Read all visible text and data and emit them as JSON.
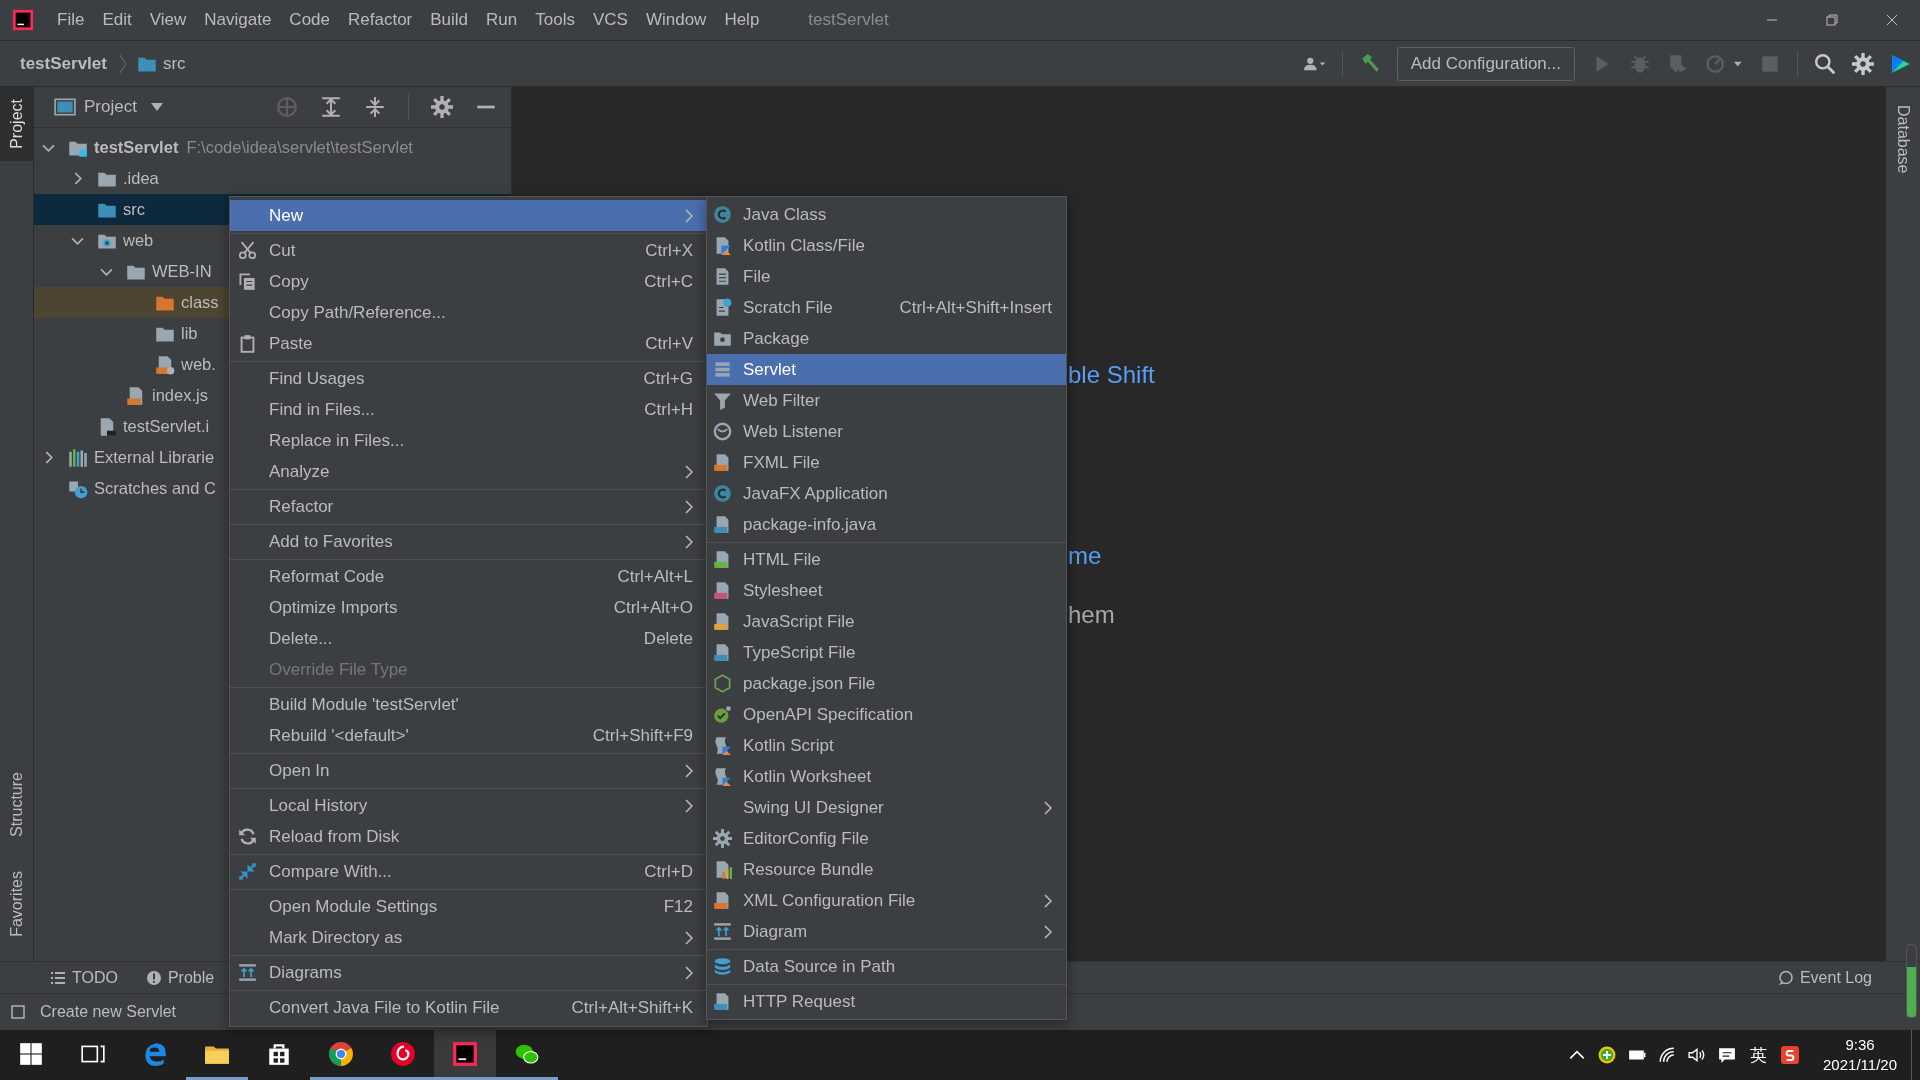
{
  "window": {
    "title": "testServlet"
  },
  "menu_bar": [
    "File",
    "Edit",
    "View",
    "Navigate",
    "Code",
    "Refactor",
    "Build",
    "Run",
    "Tools",
    "VCS",
    "Window",
    "Help"
  ],
  "nav_bar": {
    "breadcrumbs": [
      "testServlet",
      "src"
    ],
    "run_config": "Add Configuration..."
  },
  "left_stripe": [
    {
      "label": "Project",
      "selected": true
    },
    {
      "label": "Structure",
      "selected": false
    },
    {
      "label": "Favorites",
      "selected": false
    }
  ],
  "right_stripe": [
    {
      "label": "Database",
      "selected": false
    }
  ],
  "project_panel": {
    "title": "Project",
    "tree": [
      {
        "label": "testServlet",
        "kind": "module",
        "path": "F:\\code\\idea\\servlet\\testServlet",
        "expanded": true,
        "selected": false,
        "children": [
          {
            "label": ".idea",
            "kind": "folder",
            "expanded": false,
            "selected": false
          },
          {
            "label": "src",
            "kind": "source",
            "selected": true
          },
          {
            "label": "web",
            "kind": "web",
            "expanded": true,
            "selected": false,
            "children": [
              {
                "label": "WEB-IN",
                "kind": "folder",
                "expanded": true,
                "selected": false,
                "children": [
                  {
                    "label": "class",
                    "kind": "output",
                    "selected": false
                  },
                  {
                    "label": "lib",
                    "kind": "folder",
                    "selected": false
                  },
                  {
                    "label": "web.",
                    "kind": "xml",
                    "selected": false
                  }
                ]
              },
              {
                "label": "index.js",
                "kind": "jsp",
                "selected": false
              }
            ]
          },
          {
            "label": "testServlet.i",
            "kind": "iml",
            "selected": false
          }
        ]
      },
      {
        "label": "External Librarie",
        "kind": "libraries",
        "expanded": false,
        "selected": false
      },
      {
        "label": "Scratches and C",
        "kind": "scratches",
        "selected": false
      }
    ]
  },
  "editor_hints": [
    {
      "text": "ble Shift",
      "kind": "link"
    },
    {
      "text": "me",
      "kind": "link"
    },
    {
      "text": "hem",
      "kind": "plain"
    }
  ],
  "context_menu": {
    "groups": [
      [
        {
          "label": "New",
          "has_submenu": true,
          "selected": true,
          "disabled": false
        }
      ],
      [
        {
          "label": "Cut",
          "shortcut": "Ctrl+X",
          "has_submenu": false,
          "selected": false,
          "disabled": false
        },
        {
          "label": "Copy",
          "shortcut": "Ctrl+C",
          "has_submenu": false,
          "selected": false,
          "disabled": false
        },
        {
          "label": "Copy Path/Reference...",
          "has_submenu": false,
          "selected": false,
          "disabled": false
        },
        {
          "label": "Paste",
          "shortcut": "Ctrl+V",
          "has_submenu": false,
          "selected": false,
          "disabled": false
        }
      ],
      [
        {
          "label": "Find Usages",
          "shortcut": "Ctrl+G",
          "has_submenu": false,
          "selected": false,
          "disabled": false
        },
        {
          "label": "Find in Files...",
          "shortcut": "Ctrl+H",
          "has_submenu": false,
          "selected": false,
          "disabled": false
        },
        {
          "label": "Replace in Files...",
          "has_submenu": false,
          "selected": false,
          "disabled": false
        },
        {
          "label": "Analyze",
          "has_submenu": true,
          "selected": false,
          "disabled": false
        }
      ],
      [
        {
          "label": "Refactor",
          "has_submenu": true,
          "selected": false,
          "disabled": false
        }
      ],
      [
        {
          "label": "Add to Favorites",
          "has_submenu": true,
          "selected": false,
          "disabled": false
        }
      ],
      [
        {
          "label": "Reformat Code",
          "shortcut": "Ctrl+Alt+L",
          "has_submenu": false,
          "selected": false,
          "disabled": false
        },
        {
          "label": "Optimize Imports",
          "shortcut": "Ctrl+Alt+O",
          "has_submenu": false,
          "selected": false,
          "disabled": false
        },
        {
          "label": "Delete...",
          "shortcut": "Delete",
          "has_submenu": false,
          "selected": false,
          "disabled": false
        },
        {
          "label": "Override File Type",
          "has_submenu": false,
          "selected": false,
          "disabled": true
        }
      ],
      [
        {
          "label": "Build Module 'testServlet'",
          "has_submenu": false,
          "selected": false,
          "disabled": false
        },
        {
          "label": "Rebuild '<default>'",
          "shortcut": "Ctrl+Shift+F9",
          "has_submenu": false,
          "selected": false,
          "disabled": false
        }
      ],
      [
        {
          "label": "Open In",
          "has_submenu": true,
          "selected": false,
          "disabled": false
        }
      ],
      [
        {
          "label": "Local History",
          "has_submenu": true,
          "selected": false,
          "disabled": false
        },
        {
          "label": "Reload from Disk",
          "has_submenu": false,
          "selected": false,
          "disabled": false
        }
      ],
      [
        {
          "label": "Compare With...",
          "shortcut": "Ctrl+D",
          "has_submenu": false,
          "selected": false,
          "disabled": false
        }
      ],
      [
        {
          "label": "Open Module Settings",
          "shortcut": "F12",
          "has_submenu": false,
          "selected": false,
          "disabled": false
        },
        {
          "label": "Mark Directory as",
          "has_submenu": true,
          "selected": false,
          "disabled": false
        }
      ],
      [
        {
          "label": "Diagrams",
          "has_submenu": true,
          "selected": false,
          "disabled": false
        }
      ],
      [
        {
          "label": "Convert Java File to Kotlin File",
          "shortcut": "Ctrl+Alt+Shift+K",
          "has_submenu": false,
          "selected": false,
          "disabled": false
        }
      ]
    ]
  },
  "new_submenu": {
    "groups": [
      [
        {
          "label": "Java Class",
          "has_submenu": false,
          "selected": false
        },
        {
          "label": "Kotlin Class/File",
          "has_submenu": false,
          "selected": false
        },
        {
          "label": "File",
          "has_submenu": false,
          "selected": false
        },
        {
          "label": "Scratch File",
          "shortcut": "Ctrl+Alt+Shift+Insert",
          "has_submenu": false,
          "selected": false
        },
        {
          "label": "Package",
          "has_submenu": false,
          "selected": false
        },
        {
          "label": "Servlet",
          "has_submenu": false,
          "selected": true
        },
        {
          "label": "Web Filter",
          "has_submenu": false,
          "selected": false
        },
        {
          "label": "Web Listener",
          "has_submenu": false,
          "selected": false
        },
        {
          "label": "FXML File",
          "has_submenu": false,
          "selected": false
        },
        {
          "label": "JavaFX Application",
          "has_submenu": false,
          "selected": false
        },
        {
          "label": "package-info.java",
          "has_submenu": false,
          "selected": false
        }
      ],
      [
        {
          "label": "HTML File",
          "has_submenu": false,
          "selected": false
        },
        {
          "label": "Stylesheet",
          "has_submenu": false,
          "selected": false
        },
        {
          "label": "JavaScript File",
          "has_submenu": false,
          "selected": false
        },
        {
          "label": "TypeScript File",
          "has_submenu": false,
          "selected": false
        },
        {
          "label": "package.json File",
          "has_submenu": false,
          "selected": false
        },
        {
          "label": "OpenAPI Specification",
          "has_submenu": false,
          "selected": false
        },
        {
          "label": "Kotlin Script",
          "has_submenu": false,
          "selected": false
        },
        {
          "label": "Kotlin Worksheet",
          "has_submenu": false,
          "selected": false
        },
        {
          "label": "Swing UI Designer",
          "has_submenu": true,
          "selected": false
        },
        {
          "label": "EditorConfig File",
          "has_submenu": false,
          "selected": false
        },
        {
          "label": "Resource Bundle",
          "has_submenu": false,
          "selected": false
        },
        {
          "label": "XML Configuration File",
          "has_submenu": true,
          "selected": false
        },
        {
          "label": "Diagram",
          "has_submenu": true,
          "selected": false
        }
      ],
      [
        {
          "label": "Data Source in Path",
          "has_submenu": false,
          "selected": false
        }
      ],
      [
        {
          "label": "HTTP Request",
          "has_submenu": false,
          "selected": false
        }
      ]
    ]
  },
  "tool_tabs": [
    "TODO",
    "Proble"
  ],
  "event_log": "Event Log",
  "status_bar": {
    "message": "Create new Servlet"
  },
  "taskbar": {
    "apps": [
      {
        "selected": false,
        "running": false
      },
      {
        "selected": false,
        "running": false
      },
      {
        "selected": false,
        "running": false
      },
      {
        "selected": false,
        "running": true
      },
      {
        "selected": false,
        "running": false
      },
      {
        "selected": false,
        "running": true
      },
      {
        "selected": false,
        "running": true
      },
      {
        "selected": true,
        "running": true
      },
      {
        "selected": false,
        "running": true
      }
    ],
    "ime": "英",
    "time": "9:36",
    "date": "2021/11/20"
  }
}
